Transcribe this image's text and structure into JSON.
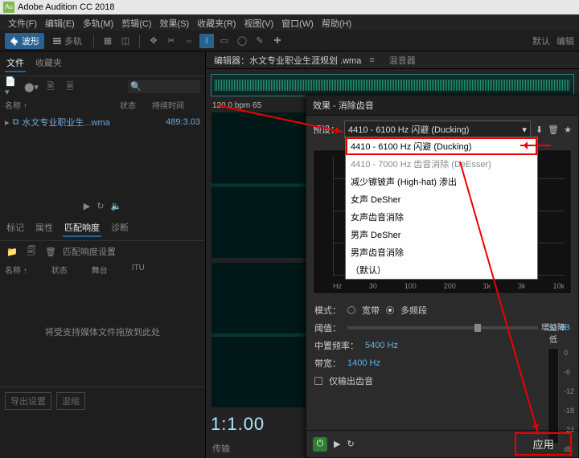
{
  "app": {
    "title": "Adobe Audition CC 2018",
    "logo_text": "Au"
  },
  "menu": {
    "file": "文件(F)",
    "edit": "编辑(E)",
    "multitrack": "多轨(M)",
    "clip": "剪辑(C)",
    "effects": "效果(S)",
    "favorites": "收藏夹(R)",
    "view": "视图(V)",
    "window": "窗口(W)",
    "help": "帮助(H)"
  },
  "toolbar": {
    "waveform": "波形",
    "multitrack": "多轨",
    "default_label": "默认",
    "edit_label": "编辑"
  },
  "left": {
    "tab_files": "文件",
    "tab_favorites": "收藏夹",
    "col_name": "名称 ↑",
    "col_status": "状态",
    "col_duration": "持续时间",
    "file_name": "水文专业职业生...wma",
    "file_duration": "489:3.03",
    "tab_marker": "标记",
    "tab_property": "属性",
    "tab_match": "匹配响度",
    "tab_diag": "诊断",
    "match_settings": "匹配响度设置",
    "col2_name": "名称 ↑",
    "col2_status": "状态",
    "col2_stage": "舞台",
    "col2_itu": "ITU",
    "dropzone": "将受支持媒体文件拖放到此处",
    "foot_export": "导出设置",
    "foot_mixdown": "混缩"
  },
  "editor": {
    "tab_label": "编辑器：水文专业职业生涯规划 .wma",
    "mixer_tab": "混音器",
    "bpm": "120.0 bpm 65",
    "timecode": "1:1.00",
    "transport_label": "传输"
  },
  "fx": {
    "title": "效果 - 消除齿音",
    "preset_label": "预设：",
    "preset_value": "4410 - 6100 Hz 闪避 (Ducking)",
    "dropdown": [
      "4410 - 6100 Hz 闪避 (Ducking)",
      "4410 - 7000 Hz 齿音消除 (DeEsser)",
      "减少镲铍声 (High-hat) 渗出",
      "女声 DeSher",
      "女声齿音消除",
      "男声 DeSher",
      "男声齿音消除",
      "（默认）"
    ],
    "axis": {
      "hz": "Hz",
      "t30": "30",
      "t100": "100",
      "t200": "200",
      "t1k": "1k",
      "t3k": "3k",
      "t10k": "10k"
    },
    "mode_label": "模式：",
    "mode_wide": "宽带",
    "mode_multi": "多频段",
    "threshold_label": "阈值：",
    "threshold_val": "-30 dB",
    "center_label": "中置频率：",
    "center_val": "5400 Hz",
    "bw_label": "带宽：",
    "bw_val": "1400 Hz",
    "output_only": "仅输出齿音",
    "gain_label": "增益降低",
    "ticks": [
      "0",
      "-6",
      "-12",
      "-18",
      "-24",
      "dB"
    ],
    "apply": "应用"
  }
}
